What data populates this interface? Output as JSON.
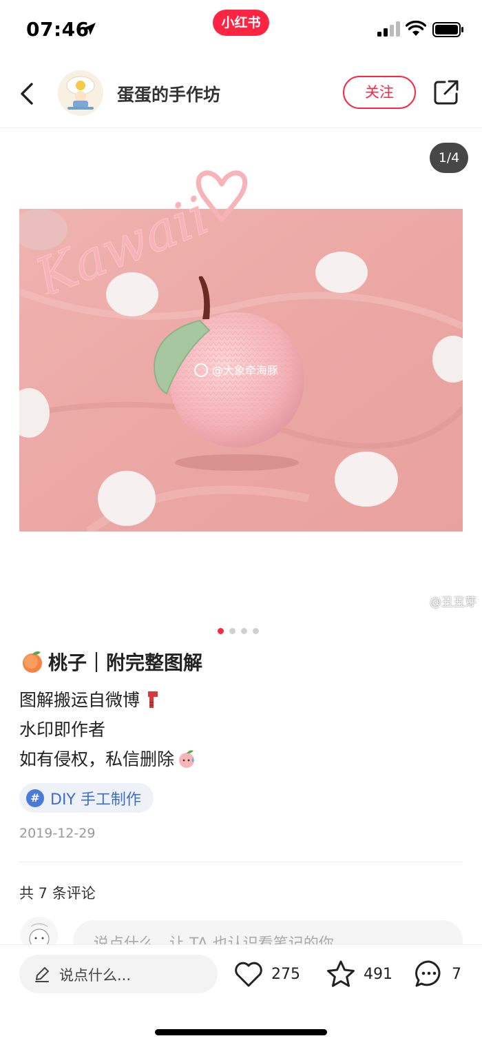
{
  "status_bar": {
    "time": "07:46",
    "app_badge": "小红书"
  },
  "header": {
    "author_name": "蛋蛋的手作坊",
    "follow_label": "关注"
  },
  "gallery": {
    "counter": "1/4",
    "watermark_center": "@大象牵海豚",
    "watermark_bottom": "@丑丑芽",
    "handwriting": "Kawaii",
    "current_page": 1,
    "total_pages": 4
  },
  "note": {
    "title": "桃子｜附完整图解",
    "body_lines": [
      "图解搬运自微博",
      "水印即作者",
      "如有侵权，私信删除"
    ],
    "tag": "DIY 手工制作",
    "date": "2019-12-29"
  },
  "comments": {
    "count_label": "共 7 条评论",
    "input_placeholder": "说点什么，让 TA 也认识看笔记的你"
  },
  "bottom_bar": {
    "say_placeholder": "说点什么...",
    "likes": "275",
    "collects": "491",
    "comments": "7"
  },
  "colors": {
    "brand": "#ff2442",
    "tag_blue": "#3c6dc8",
    "photo_pink": "#eeaaa7"
  }
}
